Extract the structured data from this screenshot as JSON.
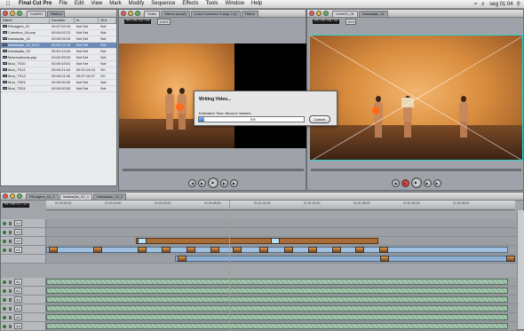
{
  "menubar": {
    "app": "Final Cut Pro",
    "items": [
      "File",
      "Edit",
      "View",
      "Mark",
      "Modify",
      "Sequence",
      "Effects",
      "Tools",
      "Window",
      "Help"
    ],
    "clock": "seg 01:04"
  },
  "browser": {
    "tabs": [
      "Corte01",
      "Efeitos"
    ],
    "columns": [
      "Name",
      "Duration",
      "In",
      "Out"
    ],
    "rows": [
      {
        "name": "Filmagem_01",
        "duration": "00:07:02:16",
        "in": "Not Set",
        "out": "Not"
      },
      {
        "name": "Colectivo_04.pnp",
        "duration": "00:04:02:21",
        "in": "Not Set",
        "out": "Not"
      },
      {
        "name": "Instalação_02",
        "duration": "00:00:05:15",
        "in": "Not Set",
        "out": "Not"
      },
      {
        "name": "Instalação_02_DVC",
        "duration": "00:00:21:23",
        "in": "Not Set",
        "out": "Not"
      },
      {
        "name": "Instalação_03",
        "duration": "00:01:12:04",
        "in": "Not Set",
        "out": "Not"
      },
      {
        "name": "Mesmosfocas.psp",
        "duration": "00:02:05:00",
        "in": "Not Set",
        "out": "Not"
      },
      {
        "name": "Mod_TS10",
        "duration": "00:00:43:01",
        "in": "Not Set",
        "out": "Not"
      },
      {
        "name": "Mod_TS12",
        "duration": "00:00:21:04",
        "in": "00:02:14:24",
        "out": "00:"
      },
      {
        "name": "Mod_TS13",
        "duration": "00:00:21:00",
        "in": "00:07:15:07",
        "out": "00:"
      },
      {
        "name": "Mod_TS23",
        "duration": "00:00:00:00",
        "in": "Not Set",
        "out": "Not"
      },
      {
        "name": "Mod_TS24",
        "duration": "00:00:00:00",
        "in": "Not Set",
        "out": "Not"
      }
    ],
    "selected_row": 3
  },
  "viewer": {
    "tabs": [
      "Video",
      "Stereo (a1a2)",
      "Color Corrector 3-way 1 (s)",
      "Filters"
    ],
    "timecode_left": "00:00:02:16",
    "zoom": "100%"
  },
  "canvas": {
    "tabs": [
      "Corte01_01",
      "Instalação_02"
    ],
    "timecode_left": "00:00:06:19",
    "zoom": "50%"
  },
  "timeline": {
    "tabs": [
      "Filmagem_01_1",
      "Instalação_02_1",
      "Instalação_02_2"
    ],
    "timecode": "01:00:17:17",
    "ruler": [
      "01:00:00;00",
      "01:00:16;00",
      "01:00:32;00",
      "01:00:48;00",
      "01:01:04;00",
      "01:01:20;00",
      "01:01:36;00",
      "01:01:52;00",
      "01:02:08;00"
    ],
    "video_tracks": [
      "V4",
      "V3",
      "V2",
      "V1"
    ],
    "audio_tracks": [
      "A1",
      "A2",
      "A3",
      "A4",
      "A5",
      "A6"
    ]
  },
  "dialog": {
    "title": "Writing Video...",
    "estimate": "Estimated Time: About 6 minutes",
    "progress_percent": 5,
    "progress_label": "5%",
    "cancel_label": "Cancel"
  }
}
